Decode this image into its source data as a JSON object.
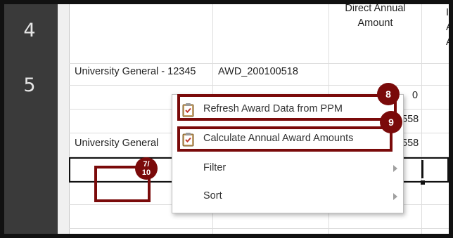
{
  "steps": {
    "step4": "4",
    "step5": "5"
  },
  "columns": {
    "direct_annual_line1": "Direct Annual",
    "direct_annual_line2": "Amount",
    "partial_col_lines": [
      "I",
      "A",
      "A"
    ]
  },
  "rows": {
    "row1_name": "University General - 12345",
    "row1_award": "AWD_200100518",
    "row1_value_a": "0",
    "row1_value_b": "558",
    "row2_name": "University General",
    "row2_value": "558"
  },
  "context_menu": {
    "items": [
      {
        "label": "Refresh Award Data from PPM",
        "icon": "clipboard-check-icon"
      },
      {
        "label": "Calculate Annual Award Amounts",
        "icon": "clipboard-check-icon"
      },
      {
        "label": "Filter",
        "icon": "chevron-right-icon"
      },
      {
        "label": "Sort",
        "icon": "chevron-right-icon"
      }
    ]
  },
  "callouts": {
    "badge_8": "8",
    "badge_9": "9",
    "badge_7_10_top": "7/",
    "badge_7_10_bottom": "10"
  },
  "colors": {
    "callout": "#7a0a0a",
    "step_bar": "#3a3a3a",
    "frame": "#111111"
  }
}
